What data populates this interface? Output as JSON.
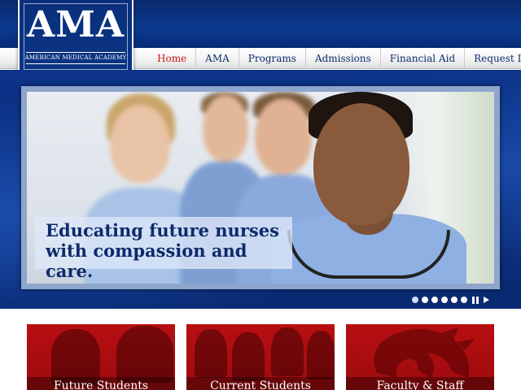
{
  "logo": {
    "title": "AMA",
    "subtitle": "AMERICAN MEDICAL ACADEMY"
  },
  "nav": {
    "items": [
      {
        "label": "Home",
        "active": true
      },
      {
        "label": "AMA",
        "active": false
      },
      {
        "label": "Programs",
        "active": false
      },
      {
        "label": "Admissions",
        "active": false
      },
      {
        "label": "Financial Aid",
        "active": false
      },
      {
        "label": "Request Info",
        "active": false
      }
    ]
  },
  "hero": {
    "caption_line1": "Educating future nurses",
    "caption_line2": "with compassion and care.",
    "slide_count": 6,
    "active_slide": 1,
    "controls": [
      "pause-icon",
      "play-icon"
    ]
  },
  "cards": [
    {
      "label": "Future Students"
    },
    {
      "label": "Current Students"
    },
    {
      "label": "Faculty & Staff"
    }
  ],
  "colors": {
    "brand_blue": "#0b3584",
    "nav_text": "#0b2d6c",
    "nav_active": "#c81818",
    "card_red": "#b80f12"
  }
}
